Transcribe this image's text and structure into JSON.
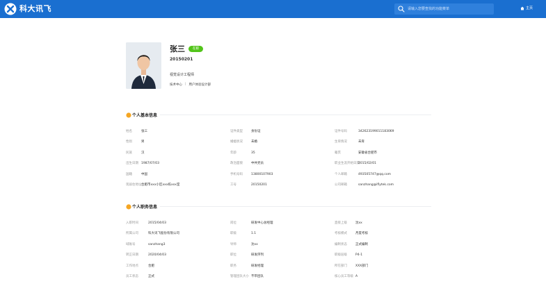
{
  "topbar": {
    "logo_text": "科大讯飞",
    "search_placeholder": "请输入您要查找的功能菜单",
    "home_label": "主页"
  },
  "profile": {
    "name": "张三",
    "status": "在职",
    "employee_id": "20150201",
    "job_title": "视觉设计工程师",
    "department": "技术中心",
    "separator": "|",
    "team": "用户体验设计部"
  },
  "basic_info": {
    "title": "个人基本信息",
    "fields": [
      {
        "label": "姓名",
        "value": "张三"
      },
      {
        "label": "证件类型",
        "value": "身份证"
      },
      {
        "label": "证件号码",
        "value": "342623199011183069"
      },
      {
        "label": "性别",
        "value": "男"
      },
      {
        "label": "婚姻状况",
        "value": "未婚"
      },
      {
        "label": "生育情况",
        "value": "未育"
      },
      {
        "label": "民族",
        "value": "汉"
      },
      {
        "label": "年龄",
        "value": "35"
      },
      {
        "label": "籍贯",
        "value": "安徽省合肥市"
      },
      {
        "label": "出生日期",
        "value": "1987/07/03"
      },
      {
        "label": "政治面貌",
        "value": "中共党员"
      },
      {
        "label": "职业生涯开始日期",
        "value": "2015/02/01"
      },
      {
        "label": "国籍",
        "value": "中国"
      },
      {
        "label": "手机号码",
        "value": "13800107903"
      },
      {
        "label": "个人邮箱",
        "value": "493505747@qq.com"
      },
      {
        "label": "现居住地址",
        "value": "合肥市xxx小区xxx栋xxx室"
      },
      {
        "label": "工号",
        "value": "20150201"
      },
      {
        "label": "公司邮箱",
        "value": "sanzhang@iflytek.com"
      }
    ]
  },
  "job_info": {
    "title": "个人职务信息",
    "fields": [
      {
        "label": "入职时间",
        "value": "2015/04/03"
      },
      {
        "label": "岗位",
        "value": "研发中心总经理"
      },
      {
        "label": "直接上级",
        "value": "沈xx"
      },
      {
        "label": "所属公司",
        "value": "科大讯飞股份有限公司"
      },
      {
        "label": "职级",
        "value": "1.1"
      },
      {
        "label": "考核模式",
        "value": "月度考核"
      },
      {
        "label": "域账号",
        "value": "sanzhang3"
      },
      {
        "label": "导师",
        "value": "沈xx"
      },
      {
        "label": "编制状态",
        "value": "正式编制"
      },
      {
        "label": "转正日期",
        "value": "2020/04/03"
      },
      {
        "label": "职位",
        "value": "研发序列"
      },
      {
        "label": "职级层级",
        "value": "P4-1"
      },
      {
        "label": "工作地点",
        "value": "合肥"
      },
      {
        "label": "职务",
        "value": "研发经理"
      },
      {
        "label": "所在部门",
        "value": "XXX部门"
      },
      {
        "label": "员工状态",
        "value": "正式"
      },
      {
        "label": "管理团队大小",
        "value": "不带团队"
      },
      {
        "label": "核心员工等级",
        "value": "A"
      }
    ]
  },
  "colors": {
    "topbar": "#1a6fd0",
    "status_badge": "#52c41a",
    "section_icon": "#f5a623"
  },
  "icons": {
    "logo": "iflytek-logo-icon",
    "search": "search-icon",
    "home": "home-icon",
    "section": "section-bulb-icon"
  }
}
